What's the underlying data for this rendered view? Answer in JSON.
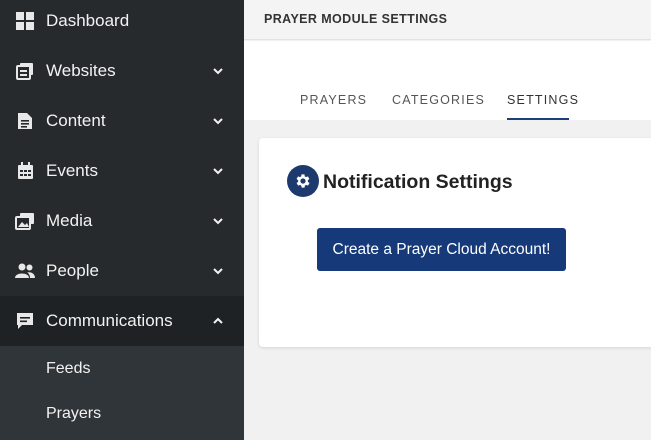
{
  "sidebar": {
    "items": [
      {
        "label": "Dashboard",
        "icon": "dashboard-icon",
        "expandable": false
      },
      {
        "label": "Websites",
        "icon": "websites-icon",
        "expandable": true
      },
      {
        "label": "Content",
        "icon": "content-icon",
        "expandable": true
      },
      {
        "label": "Events",
        "icon": "calendar-icon",
        "expandable": true
      },
      {
        "label": "Media",
        "icon": "media-icon",
        "expandable": true
      },
      {
        "label": "People",
        "icon": "people-icon",
        "expandable": true
      },
      {
        "label": "Communications",
        "icon": "chat-icon",
        "expandable": true,
        "expanded": true
      }
    ],
    "subitems": [
      {
        "label": "Feeds"
      },
      {
        "label": "Prayers"
      }
    ]
  },
  "header": {
    "title": "PRAYER MODULE SETTINGS"
  },
  "tabs": [
    {
      "label": "PRAYERS",
      "active": false
    },
    {
      "label": "CATEGORIES",
      "active": false
    },
    {
      "label": "SETTINGS",
      "active": true
    }
  ],
  "card": {
    "icon": "gear-icon",
    "title": "Notification Settings",
    "button_label": "Create a Prayer Cloud Account!"
  },
  "colors": {
    "sidebar_bg": "#262a2c",
    "submenu_bg": "#30353a",
    "accent": "#16397a",
    "tab_underline": "#1d3f7a",
    "content_bg": "#f1f1f1"
  }
}
